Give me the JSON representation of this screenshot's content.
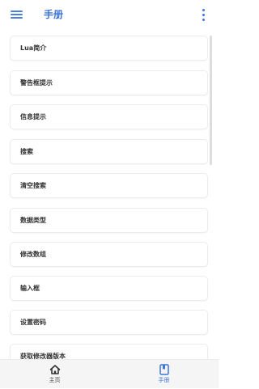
{
  "app_bar": {
    "title": "手册",
    "menu_icon": "hamburger-menu-icon",
    "more_icon": "more-vertical-icon"
  },
  "colors": {
    "accent": "#3d75d8",
    "text": "#333333",
    "card_border": "#ececec",
    "nav_background": "#f5f5f5"
  },
  "items": [
    {
      "label": "Lua简介"
    },
    {
      "label": "警告框提示"
    },
    {
      "label": "信息提示"
    },
    {
      "label": "搜索"
    },
    {
      "label": "清空搜索"
    },
    {
      "label": "数据类型"
    },
    {
      "label": "修改数组"
    },
    {
      "label": "输入框"
    },
    {
      "label": "设置密码"
    },
    {
      "label": "获取修改器版本"
    }
  ],
  "bottom_nav": {
    "selected": "手册",
    "items": [
      {
        "label": "主页",
        "icon": "home-icon"
      },
      {
        "label": "手册",
        "icon": "book-icon"
      }
    ]
  }
}
